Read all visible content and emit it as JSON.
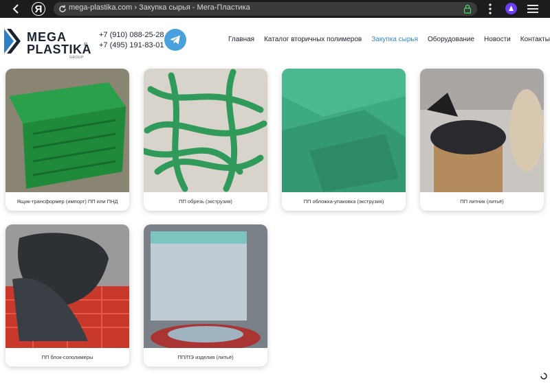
{
  "browser": {
    "url_text": "mega-plastika.com › Закупка сырья - Мега-Пластика",
    "logo_letter": "Я",
    "accent_color": "#6b3df5"
  },
  "site": {
    "logo": {
      "line1": "MEGA",
      "line2": "PLASTIKA",
      "reg": "®",
      "sub": "GROUP"
    },
    "phones": [
      "+7 (910) 088-25-28",
      "+7 (495) 191-83-01"
    ],
    "telegram_icon": "telegram-icon",
    "nav": [
      {
        "label": "Главная",
        "active": false
      },
      {
        "label": "Каталог вторичных полимеров",
        "active": false
      },
      {
        "label": "Закупка сырья",
        "active": true
      },
      {
        "label": "Оборудование",
        "active": false
      },
      {
        "label": "Новости",
        "active": false
      },
      {
        "label": "Контакты",
        "active": false
      }
    ],
    "active_color": "#3a86c8"
  },
  "products": [
    {
      "caption": "Ящик-трансформер (импорт) ПП или ПНД",
      "color": "#1f8a3a"
    },
    {
      "caption": "ПП обрезь (экструзия)",
      "color": "#2f9a5a"
    },
    {
      "caption": "ПП обложка-упаковка (экструзия)",
      "color": "#3daa80"
    },
    {
      "caption": "ПП литник (литьё)",
      "color": "#2a2a2e"
    },
    {
      "caption": "ПП блок-сополимеры",
      "color": "#2d3136"
    },
    {
      "caption": "ПП/ПЭ изделия (литьё)",
      "color": "#b8c4cc"
    }
  ]
}
